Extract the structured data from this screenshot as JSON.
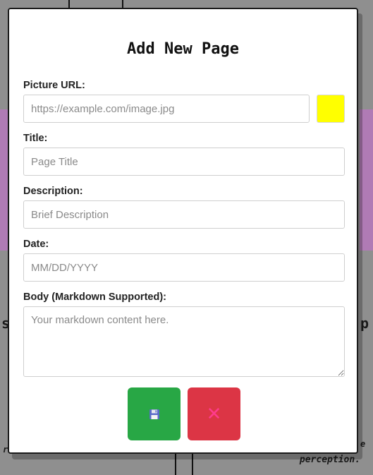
{
  "background": {
    "fragment_text": "perception.",
    "fragment_left_1": "s",
    "fragment_right_1": "p",
    "fragment_left_2": "r",
    "fragment_right_2": "e"
  },
  "modal": {
    "title": "Add New Page",
    "fields": {
      "picture_url": {
        "label": "Picture URL:",
        "placeholder": "https://example.com/image.jpg",
        "value": ""
      },
      "color_swatch": {
        "color": "#ffff00",
        "icon": "color-picker"
      },
      "title": {
        "label": "Title:",
        "placeholder": "Page Title",
        "value": ""
      },
      "description": {
        "label": "Description:",
        "placeholder": "Brief Description",
        "value": ""
      },
      "date": {
        "label": "Date:",
        "placeholder": "MM/DD/YYYY",
        "value": ""
      },
      "body": {
        "label": "Body (Markdown Supported):",
        "placeholder": "Your markdown content here.",
        "value": ""
      }
    },
    "buttons": {
      "save": {
        "icon": "floppy-disk-icon",
        "color": "#28a745"
      },
      "cancel": {
        "icon": "close-icon",
        "glyph": "✕",
        "color": "#dc3545"
      }
    }
  }
}
